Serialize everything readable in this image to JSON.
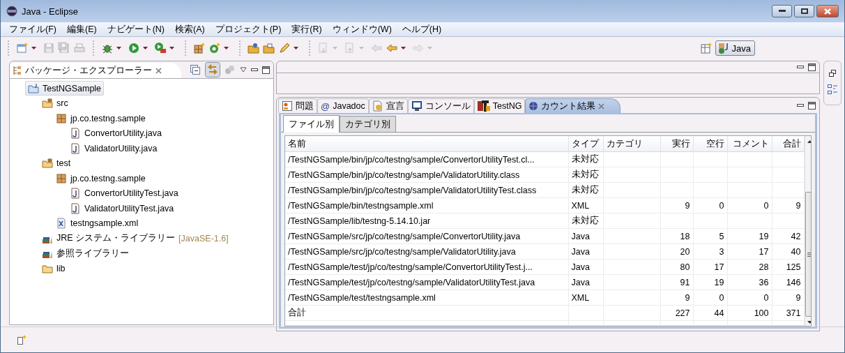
{
  "window": {
    "title": "Java - Eclipse"
  },
  "menu": [
    "ファイル(F)",
    "編集(E)",
    "ナビゲート(N)",
    "検索(A)",
    "プロジェクト(P)",
    "実行(R)",
    "ウィンドウ(W)",
    "ヘルプ(H)"
  ],
  "toolbar": [
    [
      {
        "kind": "new",
        "disabled": false,
        "menu": true
      },
      {
        "kind": "save",
        "disabled": true,
        "menu": false
      },
      {
        "kind": "save-all",
        "disabled": true,
        "menu": false
      },
      {
        "kind": "print",
        "disabled": true,
        "menu": false
      }
    ],
    [
      {
        "kind": "debug",
        "disabled": false,
        "menu": true
      },
      {
        "kind": "run",
        "disabled": false,
        "menu": true
      },
      {
        "kind": "external",
        "disabled": false,
        "menu": true
      }
    ],
    [
      {
        "kind": "new-package",
        "disabled": false,
        "menu": false
      },
      {
        "kind": "new-class",
        "disabled": false,
        "menu": true
      }
    ],
    [
      {
        "kind": "open-project",
        "disabled": false,
        "menu": false
      },
      {
        "kind": "open-folder",
        "disabled": false,
        "menu": false
      },
      {
        "kind": "pen",
        "disabled": false,
        "menu": true
      }
    ],
    [
      {
        "kind": "next",
        "disabled": true,
        "menu": true
      },
      {
        "kind": "prev",
        "disabled": true,
        "menu": true
      },
      {
        "kind": "last-edit",
        "disabled": true,
        "menu": false
      },
      {
        "kind": "back",
        "disabled": false,
        "menu": true
      },
      {
        "kind": "forward",
        "disabled": true,
        "menu": true
      }
    ]
  ],
  "perspective": {
    "label": "Java",
    "selected": true
  },
  "explorer": {
    "title": "パッケージ・エクスプローラー",
    "link_pressed": true,
    "tree": [
      {
        "label": "TestNGSample",
        "kind": "project",
        "selected": true,
        "children": [
          {
            "label": "src",
            "kind": "source-folder",
            "selected": false,
            "children": [
              {
                "label": "jp.co.testng.sample",
                "kind": "package",
                "selected": false,
                "children": [
                  {
                    "label": "ConvertorUtility.java",
                    "kind": "java",
                    "selected": false
                  },
                  {
                    "label": "ValidatorUtility.java",
                    "kind": "java",
                    "selected": false
                  }
                ]
              }
            ]
          },
          {
            "label": "test",
            "kind": "source-folder",
            "selected": false,
            "children": [
              {
                "label": "jp.co.testng.sample",
                "kind": "package",
                "selected": false,
                "children": [
                  {
                    "label": "ConvertorUtilityTest.java",
                    "kind": "java",
                    "selected": false
                  },
                  {
                    "label": "ValidatorUtilityTest.java",
                    "kind": "java",
                    "selected": false
                  }
                ]
              },
              {
                "label": "testngsample.xml",
                "kind": "xml",
                "selected": false
              }
            ]
          },
          {
            "label": "JRE システム・ライブラリー",
            "suffix": "[JavaSE-1.6]",
            "kind": "library",
            "selected": false
          },
          {
            "label": "参照ライブラリー",
            "kind": "library",
            "selected": false
          },
          {
            "label": "lib",
            "kind": "folder",
            "selected": false
          }
        ]
      }
    ]
  },
  "bottom_tabs": [
    {
      "label": "問題",
      "kind": "problems",
      "selected": false,
      "closable": false
    },
    {
      "label": "Javadoc",
      "kind": "javadoc",
      "glyph": "@",
      "selected": false,
      "closable": false
    },
    {
      "label": "宣言",
      "kind": "declaration",
      "selected": false,
      "closable": false
    },
    {
      "label": "コンソール",
      "kind": "console",
      "selected": false,
      "closable": false
    },
    {
      "label": "TestNG",
      "kind": "testng",
      "selected": false,
      "closable": false
    },
    {
      "label": "カウント結果",
      "kind": "count",
      "selected": true,
      "closable": true
    }
  ],
  "sub_tabs": [
    {
      "label": "ファイル別",
      "selected": true
    },
    {
      "label": "カテゴリ別",
      "selected": false
    }
  ],
  "table": {
    "columns": [
      "名前",
      "タイプ",
      "カテゴリ",
      "実行",
      "空行",
      "コメント",
      "合計"
    ],
    "rows": [
      [
        "/TestNGSample/bin/jp/co/testng/sample/ConvertorUtilityTest.cl...",
        "未対応",
        null,
        null,
        null,
        null,
        null
      ],
      [
        "/TestNGSample/bin/jp/co/testng/sample/ValidatorUtility.class",
        "未対応",
        null,
        null,
        null,
        null,
        null
      ],
      [
        "/TestNGSample/bin/jp/co/testng/sample/ValidatorUtilityTest.class",
        "未対応",
        null,
        null,
        null,
        null,
        null
      ],
      [
        "/TestNGSample/bin/testngsample.xml",
        "XML",
        null,
        "9",
        "0",
        "0",
        "9"
      ],
      [
        "/TestNGSample/lib/testng-5.14.10.jar",
        "未対応",
        null,
        null,
        null,
        null,
        null
      ],
      [
        "/TestNGSample/src/jp/co/testng/sample/ConvertorUtility.java",
        "Java",
        null,
        "18",
        "5",
        "19",
        "42"
      ],
      [
        "/TestNGSample/src/jp/co/testng/sample/ValidatorUtility.java",
        "Java",
        null,
        "20",
        "3",
        "17",
        "40"
      ],
      [
        "/TestNGSample/test/jp/co/testng/sample/ConvertorUtilityTest.j...",
        "Java",
        null,
        "80",
        "17",
        "28",
        "125"
      ],
      [
        "/TestNGSample/test/jp/co/testng/sample/ValidatorUtilityTest.java",
        "Java",
        null,
        "91",
        "19",
        "36",
        "146"
      ],
      [
        "/TestNGSample/test/testngsample.xml",
        "XML",
        null,
        "9",
        "0",
        "0",
        "9"
      ],
      [
        "合計",
        null,
        null,
        "227",
        "44",
        "100",
        "371"
      ]
    ]
  }
}
